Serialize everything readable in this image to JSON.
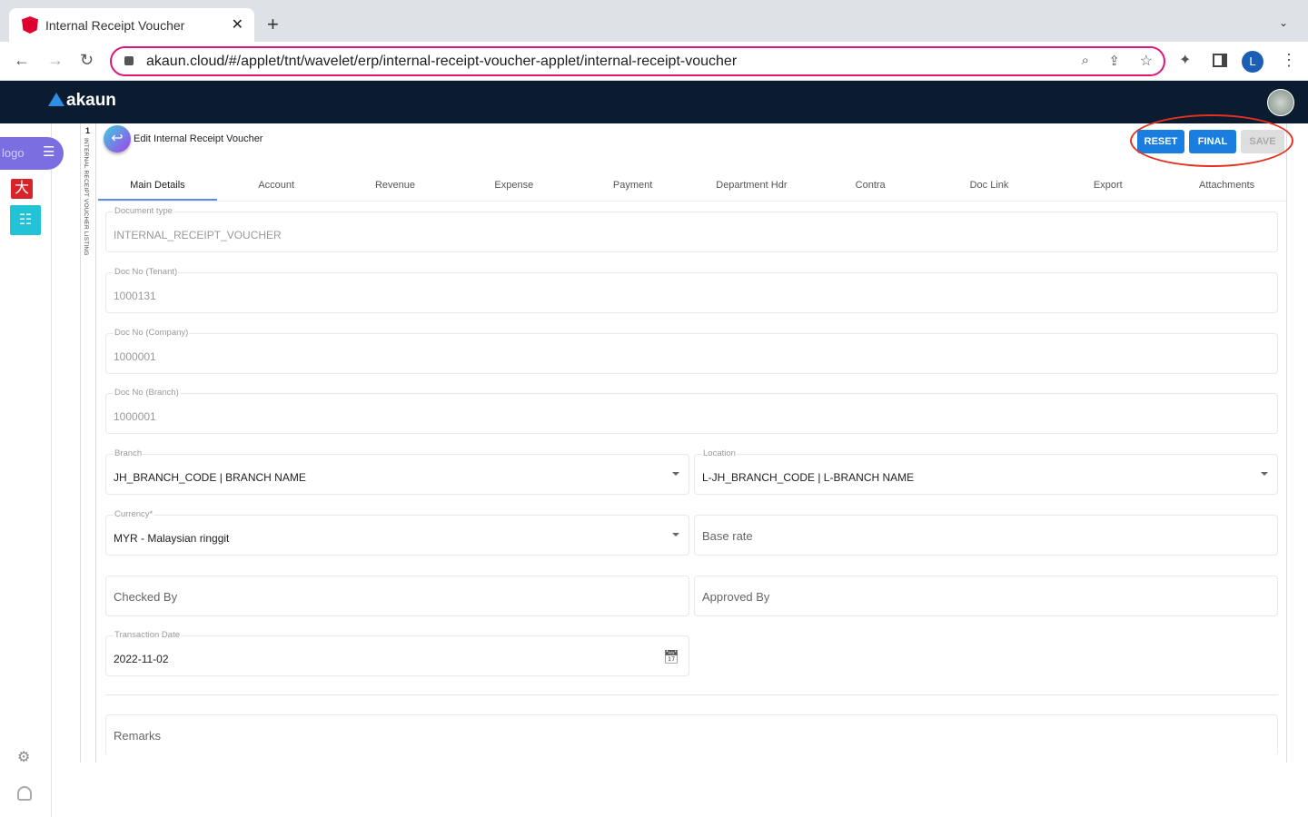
{
  "browser": {
    "tab_title": "Internal Receipt Voucher",
    "url": "akaun.cloud/#/applet/tnt/wavelet/erp/internal-receipt-voucher-applet/internal-receipt-voucher",
    "profile_initial": "L"
  },
  "app": {
    "brand": "akaun",
    "logo_alt": "logo",
    "listing_label": "1",
    "listing_vertical": "INTERNAL RECEIPT VOUCHER LISTING",
    "page_title": "Edit Internal Receipt Voucher"
  },
  "actions": {
    "reset": "RESET",
    "final": "FINAL",
    "save": "SAVE"
  },
  "tabs": [
    "Main Details",
    "Account",
    "Revenue",
    "Expense",
    "Payment",
    "Department Hdr",
    "Contra",
    "Doc Link",
    "Export",
    "Attachments"
  ],
  "form": {
    "doc_type": {
      "label": "Document type",
      "value": "INTERNAL_RECEIPT_VOUCHER"
    },
    "doc_no_tenant": {
      "label": "Doc No (Tenant)",
      "value": "1000131"
    },
    "doc_no_company": {
      "label": "Doc No (Company)",
      "value": "1000001"
    },
    "doc_no_branch": {
      "label": "Doc No (Branch)",
      "value": "1000001"
    },
    "branch": {
      "label": "Branch",
      "value": "JH_BRANCH_CODE | BRANCH NAME"
    },
    "location": {
      "label": "Location",
      "value": "L-JH_BRANCH_CODE | L-BRANCH NAME"
    },
    "currency": {
      "label": "Currency*",
      "value": "MYR - Malaysian ringgit"
    },
    "base_rate": {
      "placeholder": "Base rate"
    },
    "checked_by": {
      "placeholder": "Checked By"
    },
    "approved_by": {
      "placeholder": "Approved By"
    },
    "transaction_date": {
      "label": "Transaction Date",
      "value": "2022-11-02"
    },
    "remarks": {
      "placeholder": "Remarks"
    }
  }
}
